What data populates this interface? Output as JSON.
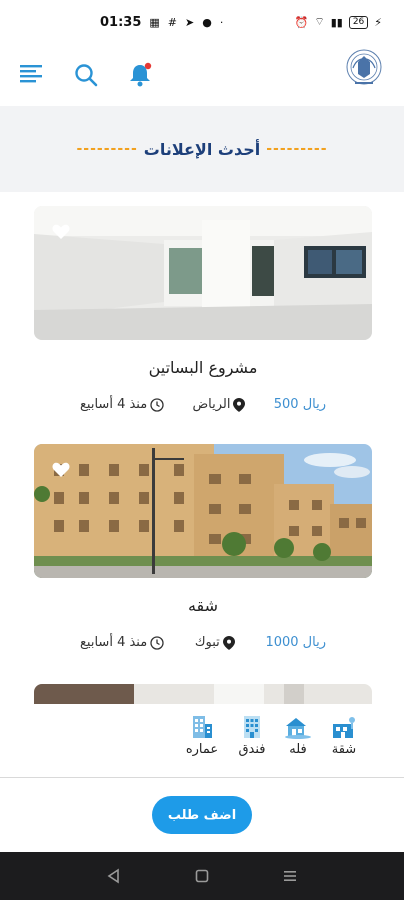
{
  "status_bar": {
    "time": "01:35",
    "battery": "26"
  },
  "header": {
    "logo_caption": ""
  },
  "section": {
    "title": "أحدث الإعلانات",
    "dashes": "---------"
  },
  "listings": [
    {
      "title": "مشروع البساتين",
      "price": "500 ريال",
      "location": "الرياض",
      "time": "منذ 4 أسابيع"
    },
    {
      "title": "شقه",
      "price": "1000 ريال",
      "location": "تبوك",
      "time": "منذ 4 أسابيع"
    }
  ],
  "categories": [
    {
      "label": "شقة",
      "icon": "apartment-icon"
    },
    {
      "label": "فله",
      "icon": "villa-icon"
    },
    {
      "label": "فندق",
      "icon": "hotel-icon"
    },
    {
      "label": "عماره",
      "icon": "building-icon"
    }
  ],
  "actions": {
    "add_request": "اضف طلب"
  },
  "colors": {
    "accent": "#1e9be8",
    "dash": "#f2a11f",
    "price": "#3d8fd0",
    "title": "#1d3f7a"
  }
}
